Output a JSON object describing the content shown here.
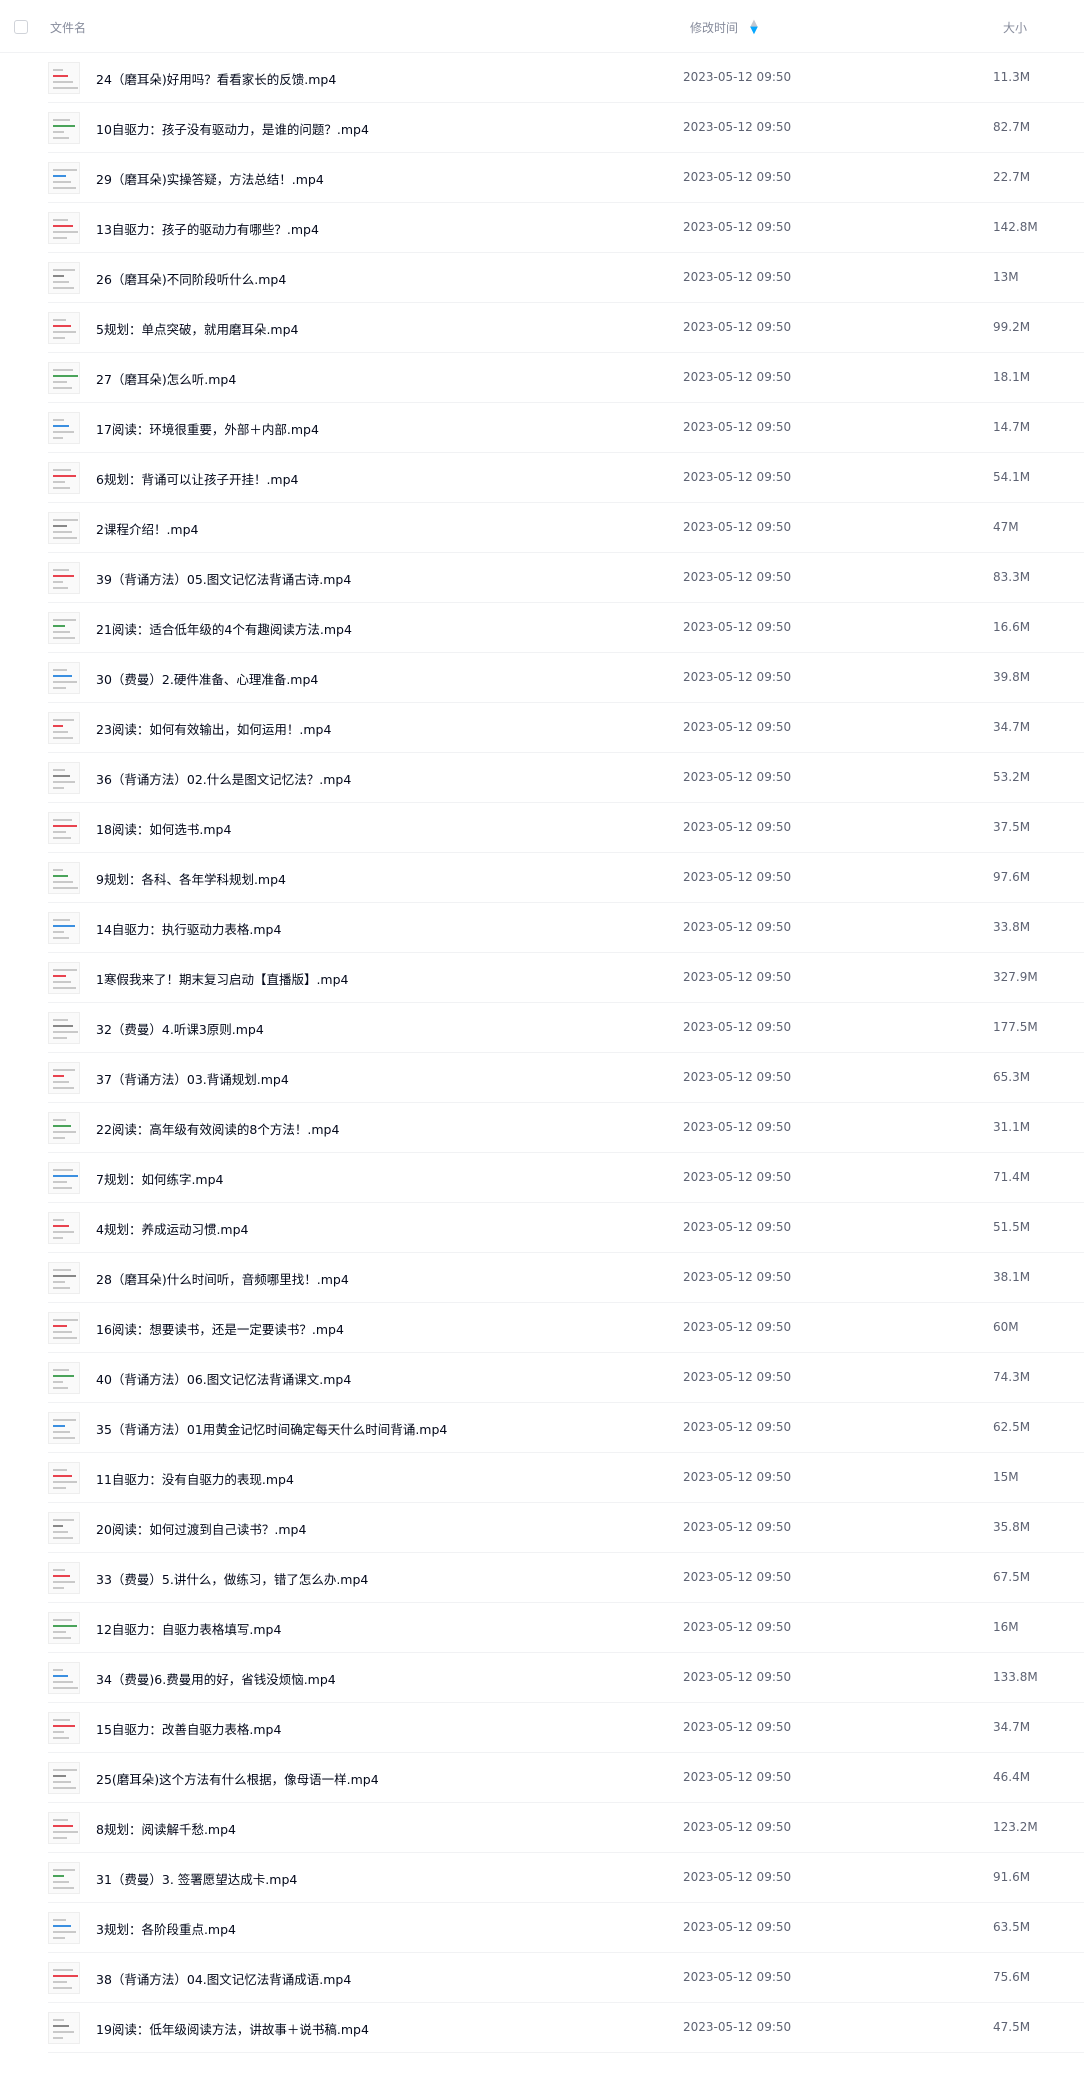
{
  "header": {
    "name_label": "文件名",
    "time_label": "修改时间",
    "size_label": "大小",
    "sort_icon": "sort-desc-icon",
    "sort_active_color": "#06a7ff"
  },
  "files": [
    {
      "name": "24（磨耳朵)好用吗？看看家长的反馈.mp4",
      "time": "2023-05-12 09:50",
      "size": "11.3M"
    },
    {
      "name": "10自驱力：孩子没有驱动力，是谁的问题？.mp4",
      "time": "2023-05-12 09:50",
      "size": "82.7M"
    },
    {
      "name": "29（磨耳朵)实操答疑，方法总结！.mp4",
      "time": "2023-05-12 09:50",
      "size": "22.7M"
    },
    {
      "name": "13自驱力：孩子的驱动力有哪些？.mp4",
      "time": "2023-05-12 09:50",
      "size": "142.8M"
    },
    {
      "name": "26（磨耳朵)不同阶段听什么.mp4",
      "time": "2023-05-12 09:50",
      "size": "13M"
    },
    {
      "name": "5规划：单点突破，就用磨耳朵.mp4",
      "time": "2023-05-12 09:50",
      "size": "99.2M"
    },
    {
      "name": "27（磨耳朵)怎么听.mp4",
      "time": "2023-05-12 09:50",
      "size": "18.1M"
    },
    {
      "name": "17阅读：环境很重要，外部＋内部.mp4",
      "time": "2023-05-12 09:50",
      "size": "14.7M"
    },
    {
      "name": "6规划：背诵可以让孩子开挂！.mp4",
      "time": "2023-05-12 09:50",
      "size": "54.1M"
    },
    {
      "name": "2课程介绍！.mp4",
      "time": "2023-05-12 09:50",
      "size": "47M"
    },
    {
      "name": "39（背诵方法）05.图文记忆法背诵古诗.mp4",
      "time": "2023-05-12 09:50",
      "size": "83.3M"
    },
    {
      "name": "21阅读：适合低年级的4个有趣阅读方法.mp4",
      "time": "2023-05-12 09:50",
      "size": "16.6M"
    },
    {
      "name": "30（费曼）2.硬件准备、心理准备.mp4",
      "time": "2023-05-12 09:50",
      "size": "39.8M"
    },
    {
      "name": "23阅读：如何有效输出，如何运用！.mp4",
      "time": "2023-05-12 09:50",
      "size": "34.7M"
    },
    {
      "name": "36（背诵方法）02.什么是图文记忆法？.mp4",
      "time": "2023-05-12 09:50",
      "size": "53.2M"
    },
    {
      "name": "18阅读：如何选书.mp4",
      "time": "2023-05-12 09:50",
      "size": "37.5M"
    },
    {
      "name": "9规划：各科、各年学科规划.mp4",
      "time": "2023-05-12 09:50",
      "size": "97.6M"
    },
    {
      "name": "14自驱力：执行驱动力表格.mp4",
      "time": "2023-05-12 09:50",
      "size": "33.8M"
    },
    {
      "name": "1寒假我来了！期末复习启动【直播版】.mp4",
      "time": "2023-05-12 09:50",
      "size": "327.9M"
    },
    {
      "name": "32（费曼）4.听课3原则.mp4",
      "time": "2023-05-12 09:50",
      "size": "177.5M"
    },
    {
      "name": "37（背诵方法）03.背诵规划.mp4",
      "time": "2023-05-12 09:50",
      "size": "65.3M"
    },
    {
      "name": "22阅读：高年级有效阅读的8个方法！.mp4",
      "time": "2023-05-12 09:50",
      "size": "31.1M"
    },
    {
      "name": "7规划：如何练字.mp4",
      "time": "2023-05-12 09:50",
      "size": "71.4M"
    },
    {
      "name": "4规划：养成运动习惯.mp4",
      "time": "2023-05-12 09:50",
      "size": "51.5M"
    },
    {
      "name": "28（磨耳朵)什么时间听，音频哪里找！.mp4",
      "time": "2023-05-12 09:50",
      "size": "38.1M"
    },
    {
      "name": "16阅读：想要读书，还是一定要读书？.mp4",
      "time": "2023-05-12 09:50",
      "size": "60M"
    },
    {
      "name": "40（背诵方法）06.图文记忆法背诵课文.mp4",
      "time": "2023-05-12 09:50",
      "size": "74.3M"
    },
    {
      "name": "35（背诵方法）01用黄金记忆时间确定每天什么时间背诵.mp4",
      "time": "2023-05-12 09:50",
      "size": "62.5M"
    },
    {
      "name": "11自驱力：没有自驱力的表现.mp4",
      "time": "2023-05-12 09:50",
      "size": "15M"
    },
    {
      "name": "20阅读：如何过渡到自己读书？.mp4",
      "time": "2023-05-12 09:50",
      "size": "35.8M"
    },
    {
      "name": "33（费曼）5.讲什么，做练习，错了怎么办.mp4",
      "time": "2023-05-12 09:50",
      "size": "67.5M"
    },
    {
      "name": "12自驱力：自驱力表格填写.mp4",
      "time": "2023-05-12 09:50",
      "size": "16M"
    },
    {
      "name": "34（费曼)6.费曼用的好，省钱没烦恼.mp4",
      "time": "2023-05-12 09:50",
      "size": "133.8M"
    },
    {
      "name": "15自驱力：改善自驱力表格.mp4",
      "time": "2023-05-12 09:50",
      "size": "34.7M"
    },
    {
      "name": "25(磨耳朵)这个方法有什么根据，像母语一样.mp4",
      "time": "2023-05-12 09:50",
      "size": "46.4M"
    },
    {
      "name": "8规划：阅读解千愁.mp4",
      "time": "2023-05-12 09:50",
      "size": "123.2M"
    },
    {
      "name": "31（费曼）3. 签署愿望达成卡.mp4",
      "time": "2023-05-12 09:50",
      "size": "91.6M"
    },
    {
      "name": "3规划：各阶段重点.mp4",
      "time": "2023-05-12 09:50",
      "size": "63.5M"
    },
    {
      "name": "38（背诵方法）04.图文记忆法背诵成语.mp4",
      "time": "2023-05-12 09:50",
      "size": "75.6M"
    },
    {
      "name": "19阅读：低年级阅读方法，讲故事＋说书稿.mp4",
      "time": "2023-05-12 09:50",
      "size": "47.5M"
    }
  ]
}
